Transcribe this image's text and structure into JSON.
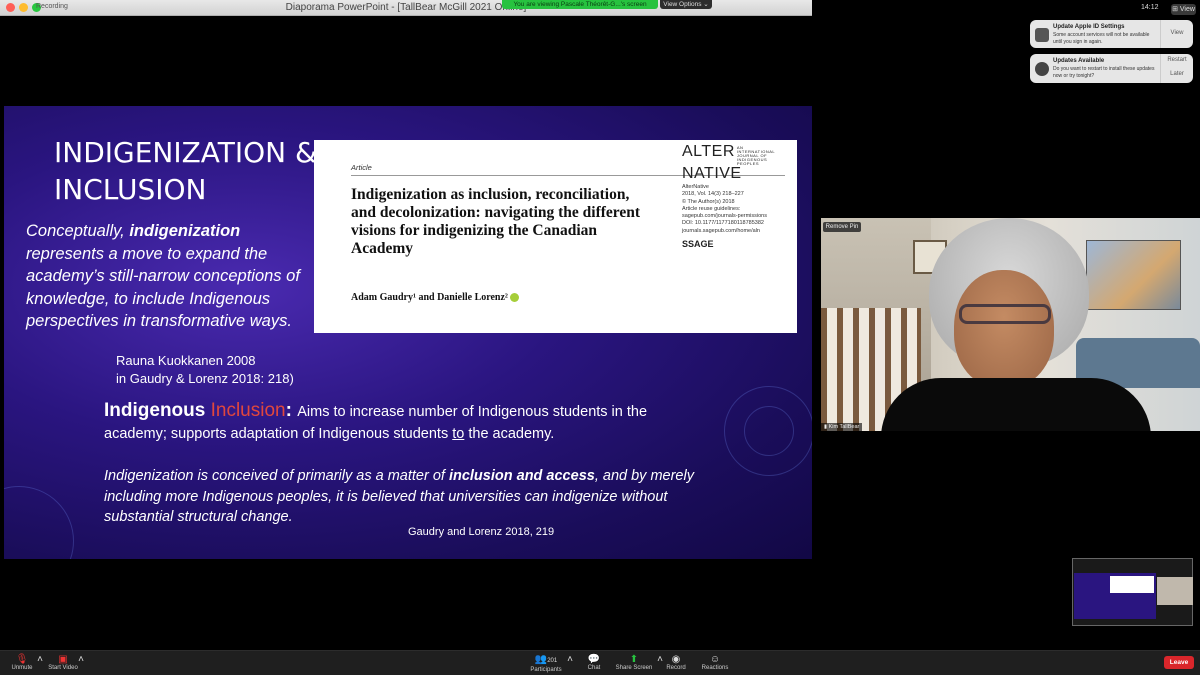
{
  "window": {
    "title": "Diaporama PowerPoint - [TallBear McGill 2021 Online]",
    "recording_label": "Recording",
    "viewing_banner": "You are viewing Pascale Théorêt-G...'s screen",
    "view_options": "View Options ⌄"
  },
  "menubar": {
    "clock": "14:12",
    "view_label": "⊞ View"
  },
  "notifications": [
    {
      "title": "Update Apple ID Settings",
      "body": "Some account services will not be available until you sign in again.",
      "buttons": [
        "View"
      ]
    },
    {
      "title": "Updates Available",
      "body": "Do you want to restart to install these updates now or try tonight?",
      "buttons": [
        "Restart",
        "Later"
      ]
    }
  ],
  "slide": {
    "title_line1": "INDIGENIZATION &",
    "title_line2": "INCLUSION",
    "concept_pre": "Conceptually, ",
    "concept_bold": "indigenization",
    "concept_rest": " represents a move to expand the academy’s still-narrow conceptions of knowledge, to include Indigenous perspectives in transformative ways.",
    "cite1_line1": "Rauna Kuokkanen 2008",
    "cite1_line2": "in Gaudry & Lorenz 2018: 218)",
    "inclusion_word1": "Indigenous ",
    "inclusion_word2": "Inclusion",
    "inclusion_colon": ": ",
    "inclusion_text_pre": "Aims to increase number of Indigenous students in the academy; supports adaptation of Indigenous students ",
    "inclusion_text_to": "to",
    "inclusion_text_post": " the academy.",
    "conceived_pre": "Indigenization is conceived of primarily as a matter of ",
    "conceived_bold": "inclusion and access",
    "conceived_post": ", and by merely including more Indigenous peoples, it is believed that universities can indigenize without substantial structural change.",
    "cite2": "Gaudry and Lorenz 2018, 219"
  },
  "article": {
    "label": "Article",
    "journal_top": "ALTER",
    "journal_sub": "AN INTERNATIONAL JOURNAL OF INDIGENOUS PEOPLES",
    "journal_bottom": "NATIVE",
    "title": "Indigenization as inclusion, reconciliation, and decolonization: navigating the different visions for indigenizing the Canadian Academy",
    "meta": [
      "AlterNative",
      "2018, Vol. 14(3) 218–227",
      "© The Author(s) 2018",
      "Article reuse guidelines:",
      "sagepub.com/journals-permissions",
      "DOI: 10.1177/1177180118785382",
      "journals.sagepub.com/home/aln"
    ],
    "publisher": "SSAGE",
    "authors": "Adam Gaudry¹ and Danielle Lorenz²"
  },
  "video": {
    "remove_pin": "Remove Pin",
    "participant_name": "Kim TallBear"
  },
  "toolbar": {
    "unmute": "Unmute",
    "start_video": "Start Video",
    "participants": "Participants",
    "participants_count": "201",
    "chat": "Chat",
    "share_screen": "Share Screen",
    "record": "Record",
    "reactions": "Reactions",
    "leave": "Leave"
  },
  "colors": {
    "zoom_green": "#27c23f",
    "leave_red": "#d9262b",
    "slide_accent_red": "#e0473d"
  }
}
